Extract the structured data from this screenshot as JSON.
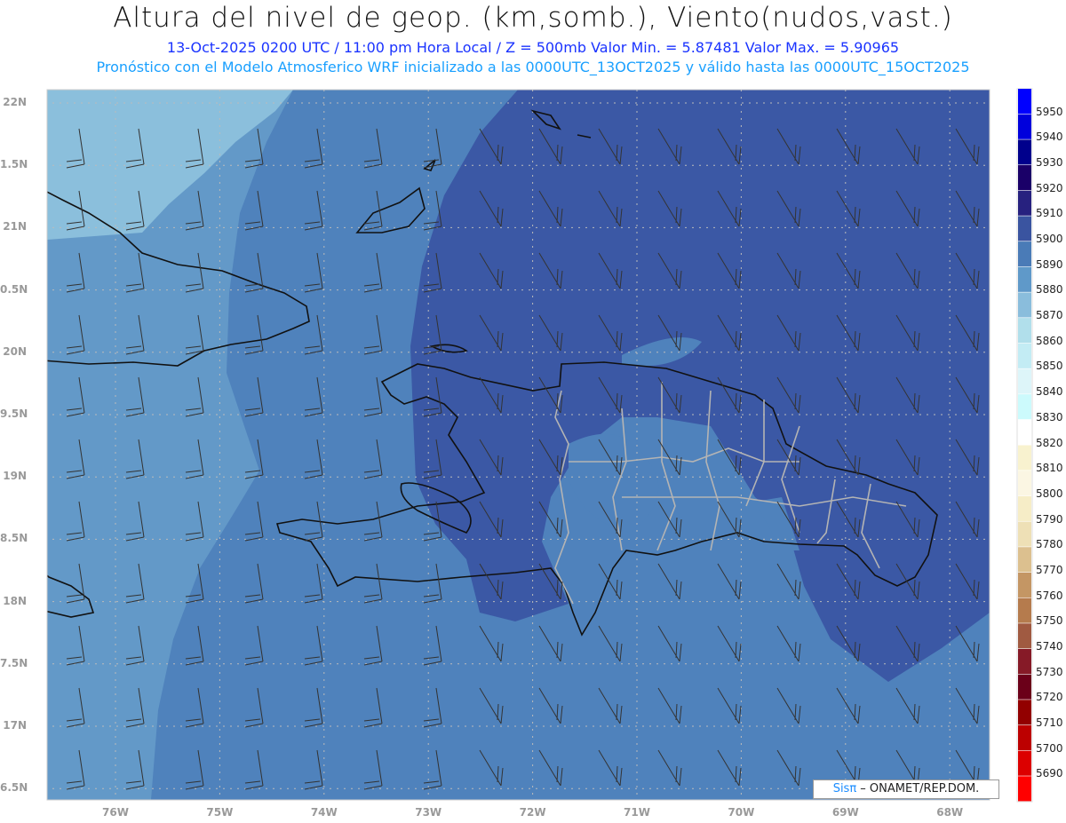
{
  "header": {
    "title": "Altura del nivel de geop. (km,somb.), Viento(nudos,vast.)",
    "subtitle": "13-Oct-2025  0200 UTC / 11:00 pm Hora Local / Z = 500mb    Valor Min. = 5.87481   Valor Max. = 5.90965",
    "model_line": "Pronóstico con el Modelo Atmosferico WRF inicializado a las 0000UTC_13OCT2025 y válido hasta las  0000UTC_15OCT2025"
  },
  "axes": {
    "lat_labels": [
      "22N",
      "1.5N",
      "21N",
      "0.5N",
      "20N",
      "9.5N",
      "19N",
      "8.5N",
      "18N",
      "7.5N",
      "17N",
      "6.5N"
    ],
    "lon_labels": [
      "76W",
      "75W",
      "74W",
      "73W",
      "72W",
      "71W",
      "70W",
      "69W",
      "68W"
    ]
  },
  "colorbar": {
    "labels": [
      "5950",
      "5940",
      "5930",
      "5920",
      "5910",
      "5900",
      "5890",
      "5880",
      "5870",
      "5860",
      "5850",
      "5840",
      "5830",
      "5820",
      "5810",
      "5800",
      "5790",
      "5780",
      "5770",
      "5760",
      "5750",
      "5740",
      "5730",
      "5720",
      "5710",
      "5700",
      "5690"
    ],
    "colors": [
      "#0000ff",
      "#0000dc",
      "#00008c",
      "#1a0068",
      "#27217f",
      "#3a54a0",
      "#4a7bb7",
      "#5f99c9",
      "#8abddc",
      "#b1dfeb",
      "#c3ecf4",
      "#ddf5f9",
      "#ccfafc",
      "#ffffff",
      "#f8f2cf",
      "#fbf6e3",
      "#f6edc7",
      "#eee0b6",
      "#dcc08f",
      "#c49664",
      "#b57b4d",
      "#a05a41",
      "#861a27",
      "#6b0019",
      "#920000",
      "#bc0000",
      "#dc0000",
      "#ff0000"
    ]
  },
  "fill_colors": {
    "lightest": "#8bbfdc",
    "light": "#6399c8",
    "mid": "#4f82bc",
    "dark": "#3b58a5"
  },
  "credit": {
    "logo": "Sisπ",
    "text": " –  ONAMET/REP.DOM."
  }
}
